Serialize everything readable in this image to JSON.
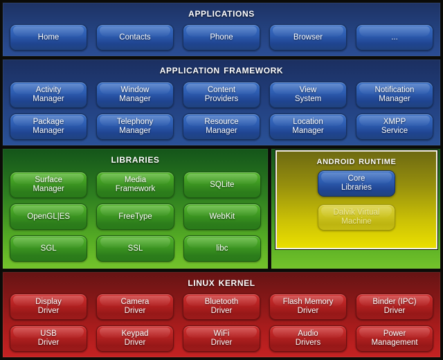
{
  "layers": {
    "applications": {
      "title": "Applications",
      "items": [
        "Home",
        "Contacts",
        "Phone",
        "Browser",
        "..."
      ]
    },
    "framework": {
      "title": "Application Framework",
      "row1": [
        "Activity\nManager",
        "Window\nManager",
        "Content\nProviders",
        "View\nSystem",
        "Notification\nManager"
      ],
      "row2": [
        "Package\nManager",
        "Telephony\nManager",
        "Resource\nManager",
        "Location\nManager",
        "XMPP\nService"
      ]
    },
    "libraries": {
      "title": "Libraries",
      "row1": [
        "Surface\nManager",
        "Media\nFramework",
        "SQLite"
      ],
      "row2": [
        "OpenGL|ES",
        "FreeType",
        "WebKit"
      ],
      "row3": [
        "SGL",
        "SSL",
        "libc"
      ]
    },
    "runtime": {
      "title": "Android Runtime",
      "items": [
        "Core\nLibraries",
        "Dalvik Virtual\nMachine"
      ]
    },
    "kernel": {
      "title": "Linux Kernel",
      "row1": [
        "Display\nDriver",
        "Camera\nDriver",
        "Bluetooth\nDriver",
        "Flash Memory\nDriver",
        "Binder (IPC)\nDriver"
      ],
      "row2": [
        "USB\nDriver",
        "Keypad\nDriver",
        "WiFi\nDriver",
        "Audio\nDrivers",
        "Power\nManagement"
      ]
    }
  },
  "colors": {
    "applications_bg": "#23407c",
    "framework_bg": "#22407f",
    "libraries_bg": "#55ab24",
    "runtime_bg": "#c9bf06",
    "kernel_bg": "#b01d1d",
    "button_blue": "#2d5cb0",
    "button_green": "#3f9a22",
    "button_red": "#b62222",
    "button_dalvik": "#cec521",
    "title_text": "#ffffff"
  }
}
